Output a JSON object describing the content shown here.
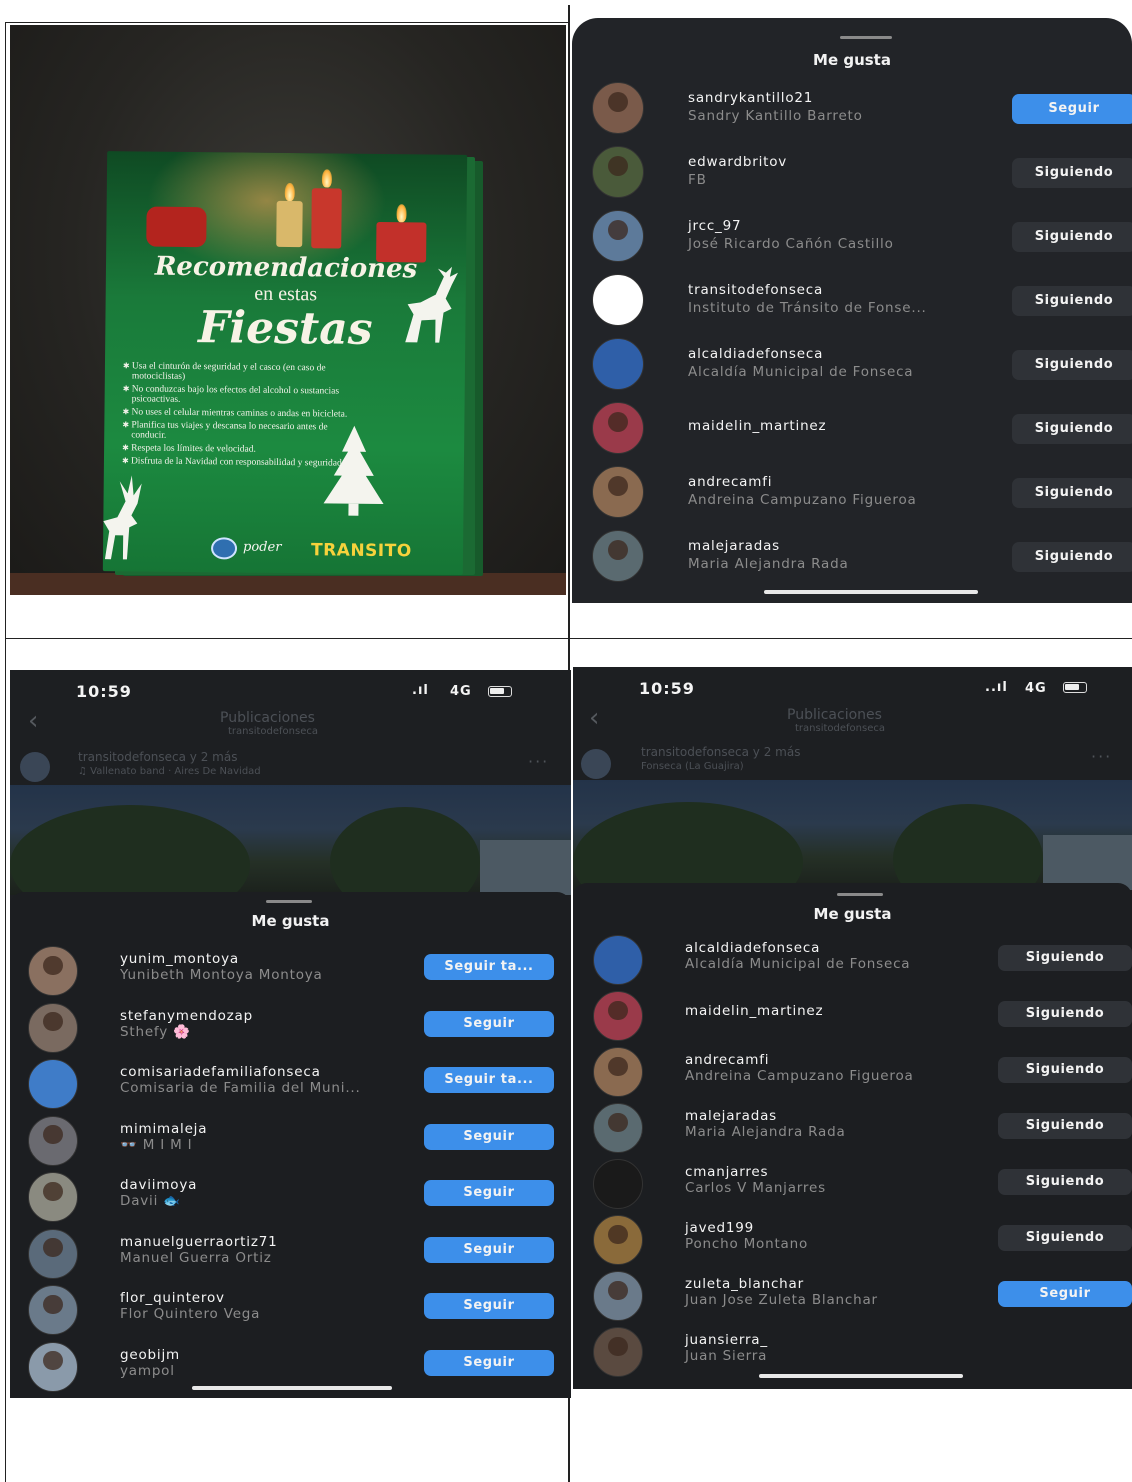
{
  "flyer": {
    "title_line1": "Recomendaciones",
    "title_line2": "en estas",
    "title_line3": "Fiestas",
    "recommendations": [
      "Usa el cinturón de seguridad y el casco (en caso de motociclistas)",
      "No conduzcas bajo los efectos del alcohol o sustancias psicoactivas.",
      "No uses el celular mientras caminas o andas en bicicleta.",
      "Planifica tus viajes y descansa lo necesario antes de conducir.",
      "Respeta los límites de velocidad.",
      "Disfruta de la Navidad con responsabilidad y seguridad."
    ],
    "logo_script": "poder",
    "logo_transito": "TRANSITO"
  },
  "panel1": {
    "title": "Me gusta",
    "rows": [
      {
        "username": "sandrykantillo21",
        "fullname": "Sandry Kantillo Barreto",
        "button": "Seguir",
        "style": "seguir",
        "avatar": "#7a5a4a"
      },
      {
        "username": "edwardbritov",
        "fullname": "FB",
        "button": "Siguiendo",
        "style": "siguiendo",
        "avatar": "#4a5a3a"
      },
      {
        "username": "jrcc_97",
        "fullname": "José Ricardo Cañón Castillo",
        "button": "Siguiendo",
        "style": "siguiendo",
        "avatar": "#5d7a9a"
      },
      {
        "username": "transitodefonseca",
        "fullname": "Instituto de Tránsito de Fonse...",
        "button": "Siguiendo",
        "style": "siguiendo",
        "avatar": "#ffffff",
        "logo": true
      },
      {
        "username": "alcaldiadefonseca",
        "fullname": "Alcaldía Municipal de Fonseca",
        "button": "Siguiendo",
        "style": "siguiendo",
        "avatar": "#2f5fa8",
        "logo": true
      },
      {
        "username": "maidelin_martinez",
        "fullname": "",
        "button": "Siguiendo",
        "style": "siguiendo",
        "avatar": "#9a3a4a"
      },
      {
        "username": "andrecamfi",
        "fullname": "Andreina Campuzano Figueroa",
        "button": "Siguiendo",
        "style": "siguiendo",
        "avatar": "#8a6a50"
      },
      {
        "username": "malejaradas",
        "fullname": "Maria Alejandra Rada",
        "button": "Siguiendo",
        "style": "siguiendo",
        "avatar": "#5a6a70"
      }
    ]
  },
  "panel2": {
    "status": {
      "time": "10:59",
      "network": "4G"
    },
    "header": {
      "title": "Publicaciones",
      "subtitle": "transitodefonseca"
    },
    "post": {
      "authors": "transitodefonseca y 2 más",
      "audio": "♫ Vallenato band · Aires De Navidad"
    },
    "title": "Me gusta",
    "rows": [
      {
        "username": "yunim_montoya",
        "fullname": "Yunibeth Montoya Montoya",
        "button": "Seguir ta...",
        "avatar": "#8a7060"
      },
      {
        "username": "stefanymendozap",
        "fullname": "Sthefy 🌸",
        "button": "Seguir",
        "avatar": "#7a6a60"
      },
      {
        "username": "comisariadefamiliafonseca",
        "fullname": "Comisaria de Familia del Muni...",
        "button": "Seguir ta...",
        "avatar": "#3f7cc8",
        "logo": true
      },
      {
        "username": "mimimaleja",
        "fullname": "👓 M I M I",
        "button": "Seguir",
        "avatar": "#6a6a70"
      },
      {
        "username": "daviimoya",
        "fullname": "Davii 🐟",
        "button": "Seguir",
        "avatar": "#8a8a80"
      },
      {
        "username": "manuelguerraortiz71",
        "fullname": "Manuel Guerra Ortiz",
        "button": "Seguir",
        "avatar": "#5a6a7a"
      },
      {
        "username": "flor_quinterov",
        "fullname": "Flor Quintero Vega",
        "button": "Seguir",
        "avatar": "#6a7a8a"
      },
      {
        "username": "geobijm",
        "fullname": "yampol",
        "button": "Seguir",
        "avatar": "#8a9aaa"
      }
    ]
  },
  "panel3": {
    "status": {
      "time": "10:59",
      "network": "4G"
    },
    "header": {
      "title": "Publicaciones",
      "subtitle": "transitodefonseca"
    },
    "post": {
      "authors": "transitodefonseca y 2 más",
      "location": "Fonseca (La Guajira)"
    },
    "title": "Me gusta",
    "rows": [
      {
        "username": "alcaldiadefonseca",
        "fullname": "Alcaldía Municipal de Fonseca",
        "button": "Siguiendo",
        "style": "siguiendo",
        "avatar": "#2f5fa8",
        "logo": true
      },
      {
        "username": "maidelin_martinez",
        "fullname": "",
        "button": "Siguiendo",
        "style": "siguiendo",
        "avatar": "#9a3a4a"
      },
      {
        "username": "andrecamfi",
        "fullname": "Andreina Campuzano Figueroa",
        "button": "Siguiendo",
        "style": "siguiendo",
        "avatar": "#8a6a50"
      },
      {
        "username": "malejaradas",
        "fullname": "Maria Alejandra Rada",
        "button": "Siguiendo",
        "style": "siguiendo",
        "avatar": "#5a6a70"
      },
      {
        "username": "cmanjarres",
        "fullname": "Carlos V Manjarres",
        "button": "Siguiendo",
        "style": "siguiendo",
        "avatar": "#1a1a1a",
        "logo": true
      },
      {
        "username": "javed199",
        "fullname": "Poncho Montano",
        "button": "Siguiendo",
        "style": "siguiendo",
        "avatar": "#8a6a3a"
      },
      {
        "username": "zuleta_blanchar",
        "fullname": "Juan Jose Zuleta Blanchar",
        "button": "Seguir",
        "style": "seguir",
        "avatar": "#6a7a8a"
      },
      {
        "username": "juansierra_",
        "fullname": "Juan Sierra",
        "button": "",
        "style": "none",
        "avatar": "#5a4a40"
      }
    ]
  }
}
